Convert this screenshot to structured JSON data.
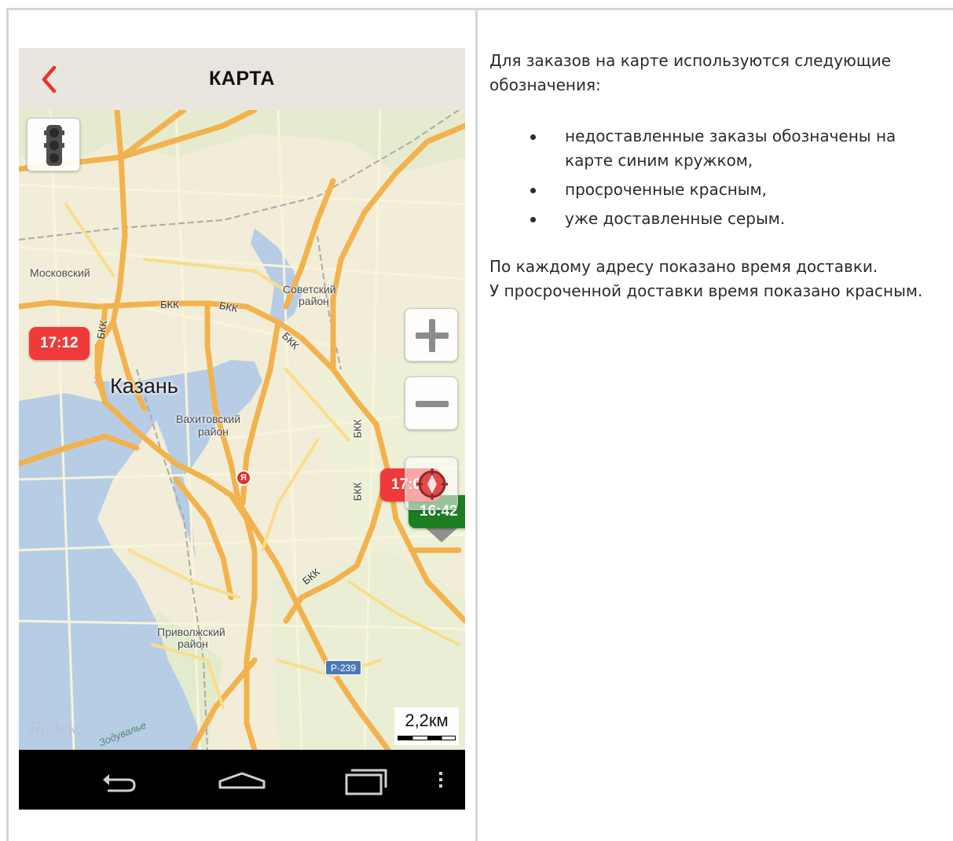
{
  "header": {
    "title": "КАРТА"
  },
  "map": {
    "labels": {
      "moskovsky": "Московский",
      "sovetsky_1": "Советский",
      "sovetsky_2": "район",
      "kazan": "Казань",
      "vakhitovsky_1": "Вахитовский",
      "vakhitovsky_2": "район",
      "privolzhsky_1": "Приволжский",
      "privolzhsky_2": "район",
      "bkk_1": "БКК",
      "bkk_2": "БКК",
      "bkk_3": "БКК",
      "bkk_4": "БКК",
      "bkk_5": "БКК",
      "bkk_6": "БКК",
      "bkk_7": "БКК",
      "route": "Р-239",
      "street": "Зодувалье",
      "watermark": "Яндекс"
    },
    "poi_marker": "Я",
    "scale": "2,2км",
    "orders": [
      {
        "time": "17:12",
        "status": "overdue",
        "color": "#f03a3a"
      },
      {
        "time": "17:04",
        "status": "overdue",
        "color": "#f03a3a"
      },
      {
        "time": "16:42",
        "status": "on-time",
        "color": "#1d7d23"
      }
    ],
    "controls": {
      "traffic": "traffic-light-icon",
      "zoom_in": "plus-icon",
      "zoom_out": "minus-icon",
      "locate": "locate-icon"
    }
  },
  "navbar": {
    "icons": [
      "back-arrow-icon",
      "home-icon",
      "recent-apps-icon",
      "overflow-menu-icon"
    ]
  },
  "doc": {
    "intro": "Для заказов на карте используются следующие обозначения:",
    "items": [
      "недоставленные заказы обозначены на карте синим кружком,",
      "просроченные красным,",
      "уже доставленные серым."
    ],
    "outro_1": "По каждому адресу показано время доставки.",
    "outro_2": "У просроченной доставки время показано красным."
  },
  "colors": {
    "overdue": "#f03a3a",
    "delivered_on_time": "#1d7d23",
    "header_bg": "#ebe5e0",
    "back_arrow": "#e8322f"
  }
}
